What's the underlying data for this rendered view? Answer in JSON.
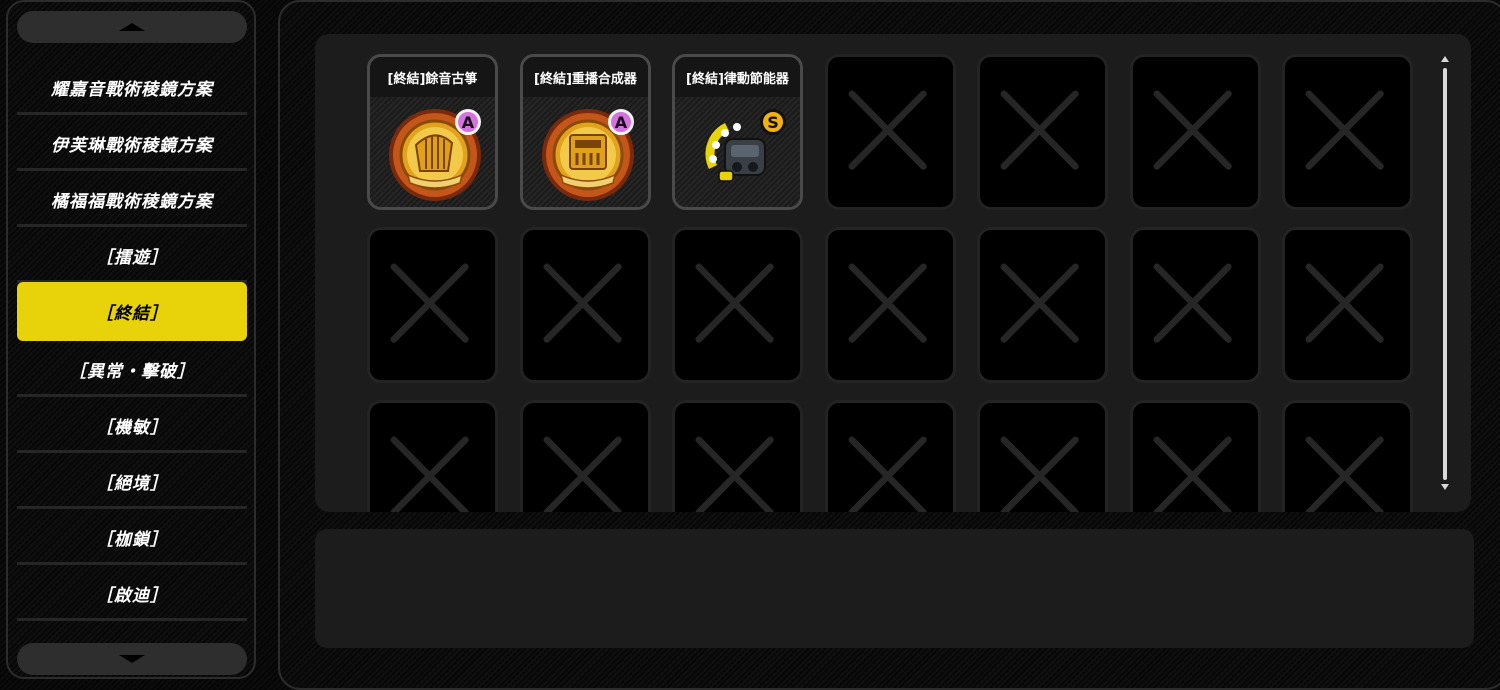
{
  "left_panel": {
    "menu_items": [
      {
        "label": "耀嘉音戰術稜鏡方案",
        "selected": false
      },
      {
        "label": "伊芙琳戰術稜鏡方案",
        "selected": false
      },
      {
        "label": "橘福福戰術稜鏡方案",
        "selected": false
      },
      {
        "label": "［擂遊］",
        "selected": false
      },
      {
        "label": "［終結］",
        "selected": true
      },
      {
        "label": "［異常・擊破］",
        "selected": false
      },
      {
        "label": "［機敏］",
        "selected": false
      },
      {
        "label": "［絕境］",
        "selected": false
      },
      {
        "label": "［枷鎖］",
        "selected": false
      },
      {
        "label": "［啟迪］",
        "selected": false
      }
    ]
  },
  "grid": {
    "columns": 7,
    "filled_slots": [
      {
        "title": "[終結]餘音古箏",
        "rank": "A",
        "icon": "golden-harp-disc-icon"
      },
      {
        "title": "[終結]重播合成器",
        "rank": "A",
        "icon": "golden-synth-disc-icon"
      },
      {
        "title": "[終結]律動節能器",
        "rank": "S",
        "icon": "metronome-device-icon"
      }
    ],
    "empty_slot_icon": "x-mark-icon"
  },
  "colors": {
    "selected_menu_bg": "#e8d20a",
    "rank_a": "#d472e0",
    "rank_s": "#f1b20f"
  }
}
